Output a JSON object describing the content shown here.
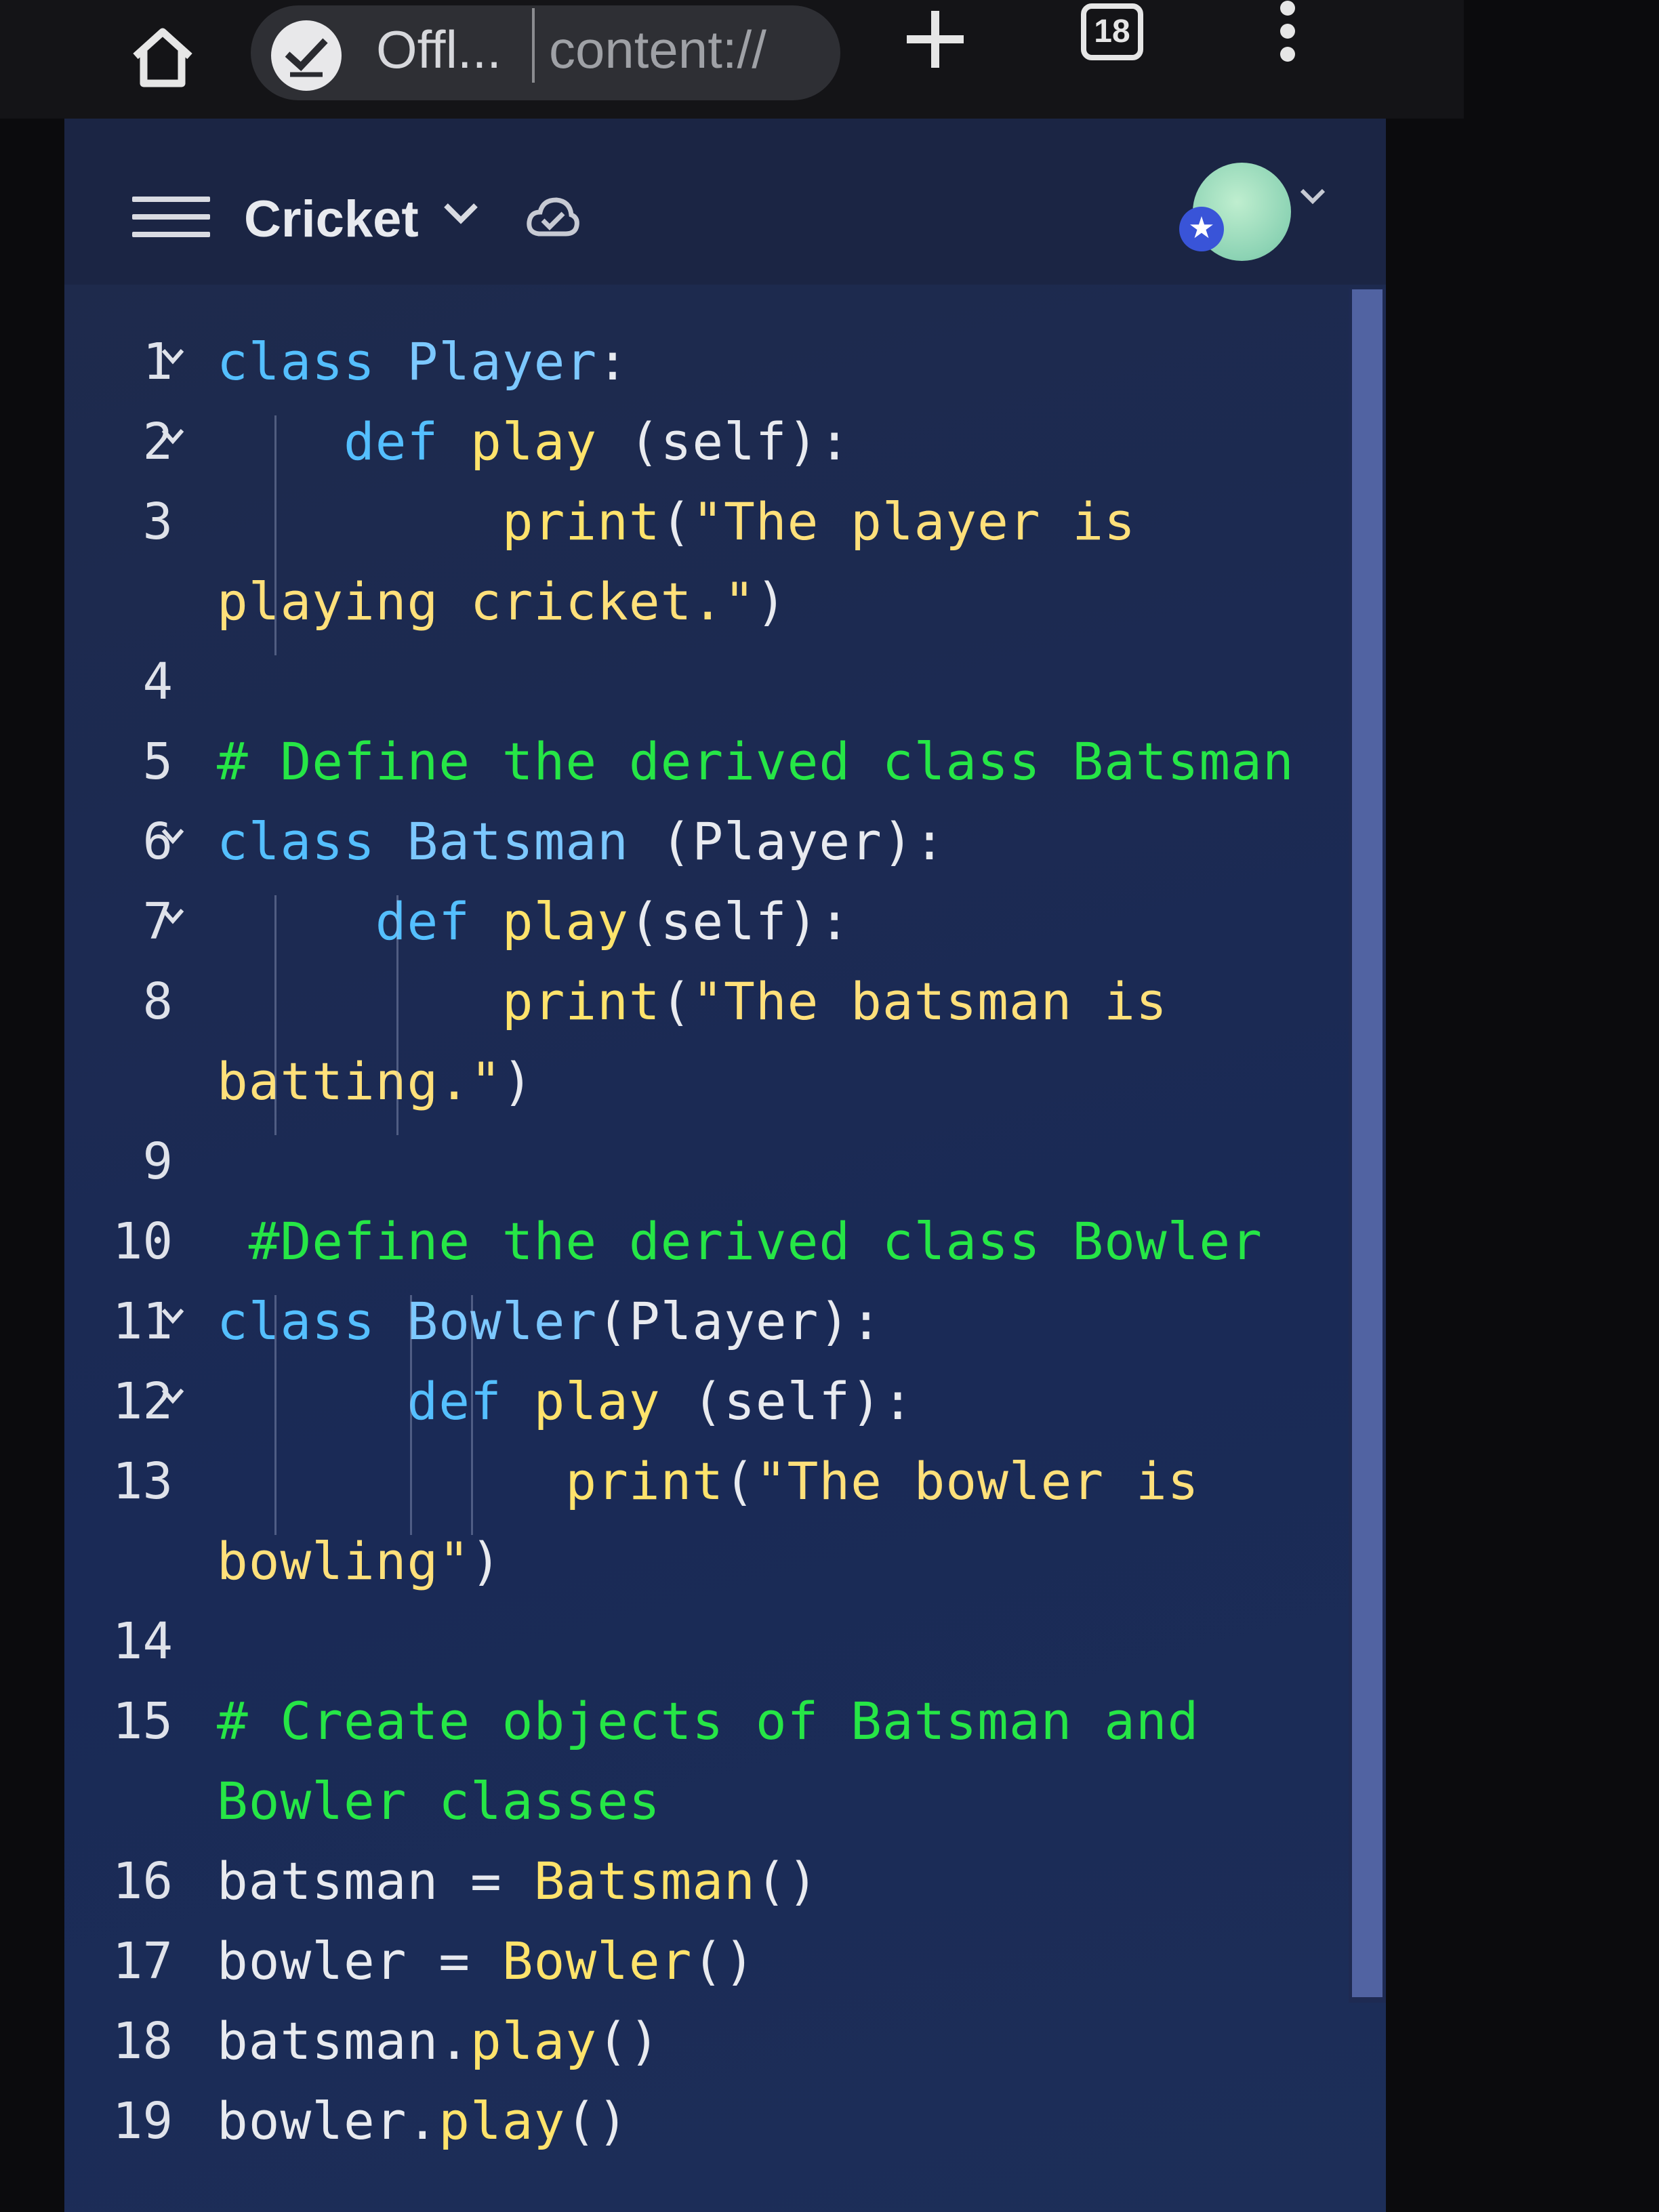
{
  "browser": {
    "tab": {
      "title": "Offl...",
      "url": "content://"
    },
    "tab_count": "18"
  },
  "app": {
    "project_name": "Cricket"
  },
  "editor": {
    "language": "python",
    "lines": [
      {
        "n": "1",
        "fold": true,
        "tokens": [
          [
            "kw",
            "class "
          ],
          [
            "cls",
            "Player"
          ],
          [
            "plain",
            ":"
          ]
        ]
      },
      {
        "n": "2",
        "fold": true,
        "tokens": [
          [
            "plain",
            "    "
          ],
          [
            "kw",
            "def "
          ],
          [
            "fn",
            "play "
          ],
          [
            "plain",
            "(self):"
          ]
        ]
      },
      {
        "n": "3",
        "fold": false,
        "tokens": [
          [
            "plain",
            "         "
          ],
          [
            "fn",
            "print"
          ],
          [
            "plain",
            "("
          ],
          [
            "str",
            "\"The player is"
          ]
        ]
      },
      {
        "n": "",
        "fold": false,
        "tokens": [
          [
            "str",
            "playing cricket.\""
          ],
          [
            "plain",
            ")"
          ]
        ]
      },
      {
        "n": "4",
        "fold": false,
        "tokens": []
      },
      {
        "n": "5",
        "fold": false,
        "tokens": [
          [
            "cmt",
            "# Define the derived class Batsman"
          ]
        ]
      },
      {
        "n": "6",
        "fold": true,
        "tokens": [
          [
            "kw",
            "class "
          ],
          [
            "cls",
            "Batsman "
          ],
          [
            "plain",
            "(Player):"
          ]
        ]
      },
      {
        "n": "7",
        "fold": true,
        "tokens": [
          [
            "plain",
            "     "
          ],
          [
            "kw",
            "def "
          ],
          [
            "fn",
            "play"
          ],
          [
            "plain",
            "(self):"
          ]
        ]
      },
      {
        "n": "8",
        "fold": false,
        "tokens": [
          [
            "plain",
            "         "
          ],
          [
            "fn",
            "print"
          ],
          [
            "plain",
            "("
          ],
          [
            "str",
            "\"The batsman is"
          ]
        ]
      },
      {
        "n": "",
        "fold": false,
        "tokens": [
          [
            "str",
            "batting.\""
          ],
          [
            "plain",
            ")"
          ]
        ]
      },
      {
        "n": "9",
        "fold": false,
        "tokens": []
      },
      {
        "n": "10",
        "fold": false,
        "tokens": [
          [
            "cmt",
            " #Define the derived class Bowler"
          ]
        ]
      },
      {
        "n": "11",
        "fold": true,
        "tokens": [
          [
            "kw",
            "class "
          ],
          [
            "cls",
            "Bowler"
          ],
          [
            "plain",
            "(Player):"
          ]
        ]
      },
      {
        "n": "12",
        "fold": true,
        "tokens": [
          [
            "plain",
            "      "
          ],
          [
            "kw",
            "def "
          ],
          [
            "fn",
            "play "
          ],
          [
            "plain",
            "(self):"
          ]
        ]
      },
      {
        "n": "13",
        "fold": false,
        "tokens": [
          [
            "plain",
            "           "
          ],
          [
            "fn",
            "print"
          ],
          [
            "plain",
            "("
          ],
          [
            "str",
            "\"The bowler is"
          ]
        ]
      },
      {
        "n": "",
        "fold": false,
        "tokens": [
          [
            "str",
            "bowling\""
          ],
          [
            "plain",
            ")"
          ]
        ]
      },
      {
        "n": "14",
        "fold": false,
        "tokens": []
      },
      {
        "n": "15",
        "fold": false,
        "tokens": [
          [
            "cmt",
            "# Create objects of Batsman and"
          ]
        ]
      },
      {
        "n": "",
        "fold": false,
        "tokens": [
          [
            "cmt",
            "Bowler classes"
          ]
        ]
      },
      {
        "n": "16",
        "fold": false,
        "tokens": [
          [
            "plain",
            "batsman = "
          ],
          [
            "fn",
            "Batsman"
          ],
          [
            "plain",
            "()"
          ]
        ]
      },
      {
        "n": "17",
        "fold": false,
        "tokens": [
          [
            "plain",
            "bowler = "
          ],
          [
            "fn",
            "Bowler"
          ],
          [
            "plain",
            "()"
          ]
        ]
      },
      {
        "n": "18",
        "fold": false,
        "tokens": [
          [
            "plain",
            "batsman."
          ],
          [
            "fn",
            "play"
          ],
          [
            "plain",
            "()"
          ]
        ]
      },
      {
        "n": "19",
        "fold": false,
        "tokens": [
          [
            "plain",
            "bowler."
          ],
          [
            "fn",
            "play"
          ],
          [
            "plain",
            "()"
          ]
        ]
      }
    ]
  },
  "icons": {
    "home": "home-icon",
    "tab_status": "offline-check-icon",
    "new_tab": "plus-icon",
    "menu": "more-vertical-icon",
    "hamburger": "hamburger-menu-icon",
    "sync": "cloud-sync-icon",
    "chevron": "chevron-down-icon"
  },
  "colors": {
    "keyword": "#54bfff",
    "function": "#ffe36b",
    "string": "#ffe07a",
    "comment": "#26e646",
    "plain": "#e8eaef",
    "editor_bg": "#1c2a52"
  }
}
